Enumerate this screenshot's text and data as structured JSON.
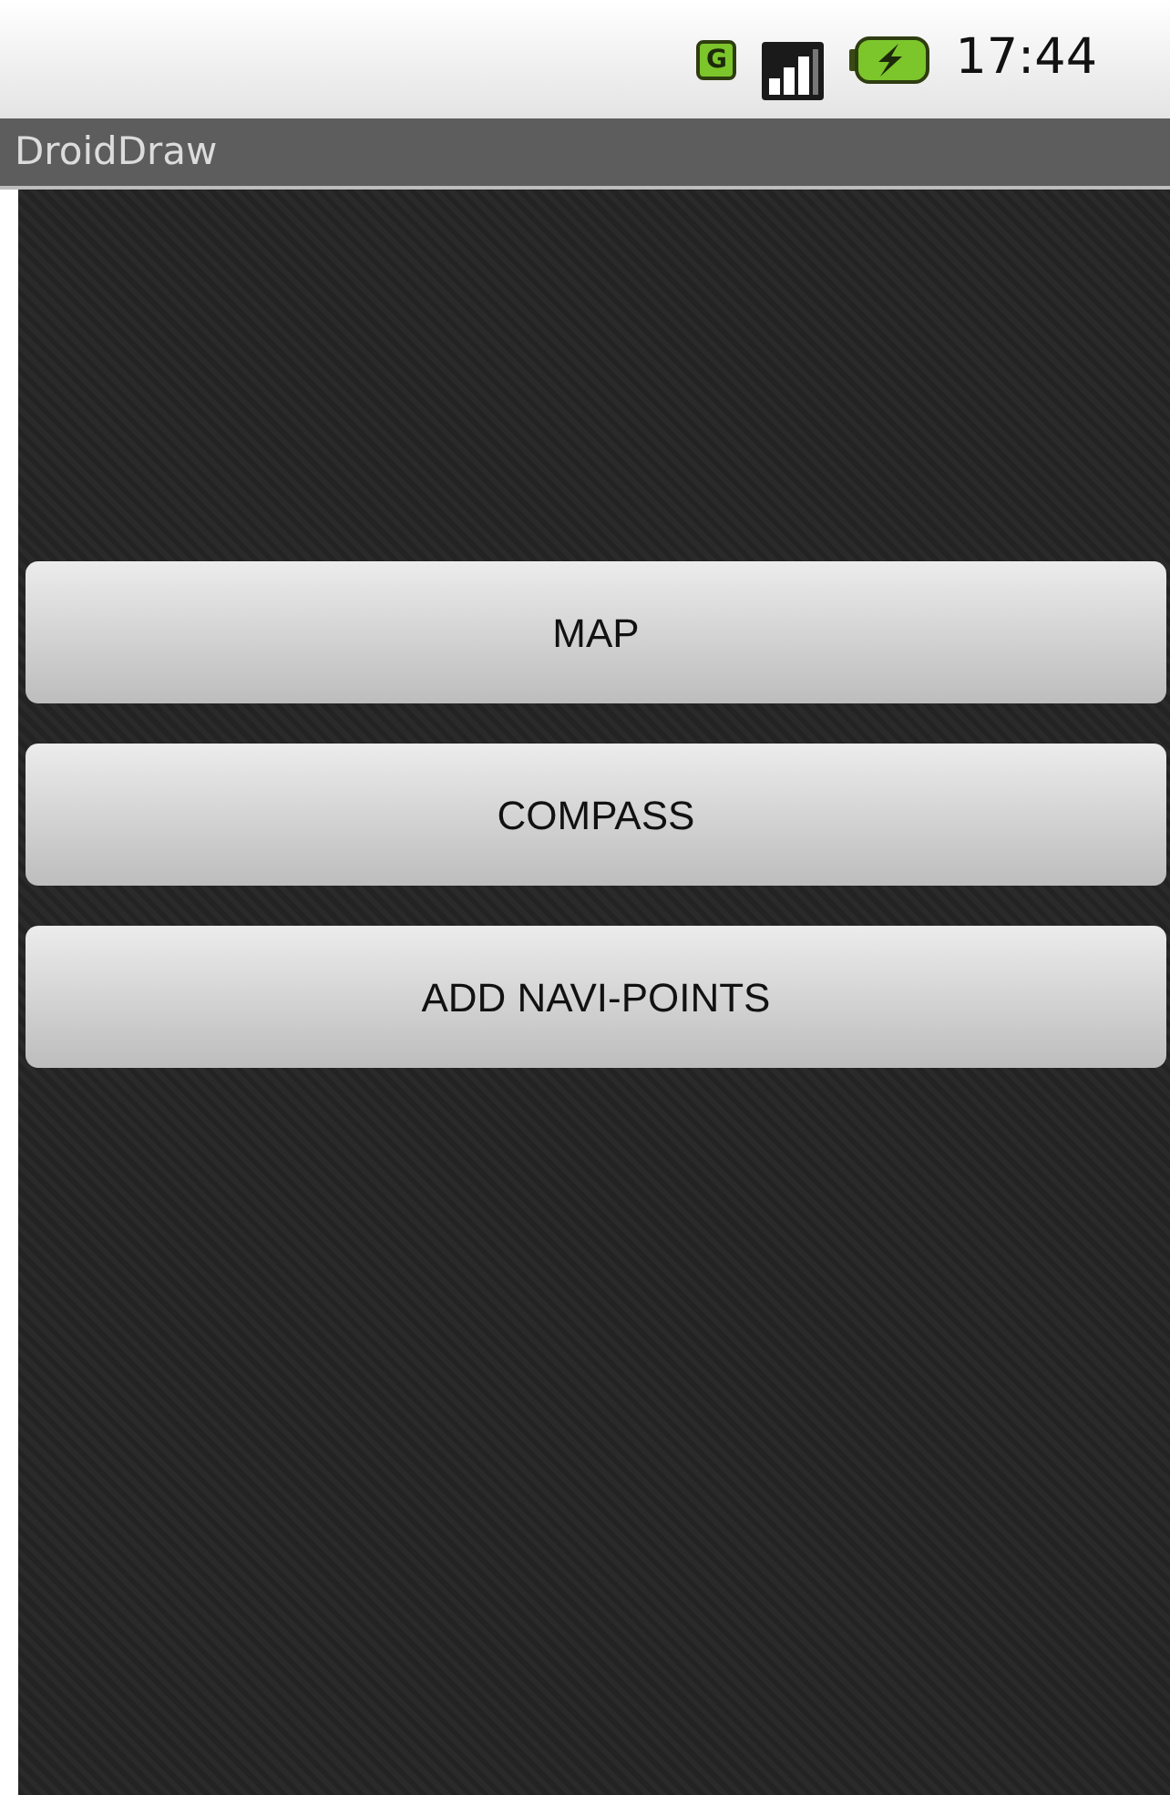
{
  "status_bar": {
    "network_type": "G",
    "time": "17:44"
  },
  "app_bar": {
    "title": "DroidDraw"
  },
  "buttons": [
    "MAP",
    "COMPASS",
    "ADD NAVI-POINTS"
  ]
}
